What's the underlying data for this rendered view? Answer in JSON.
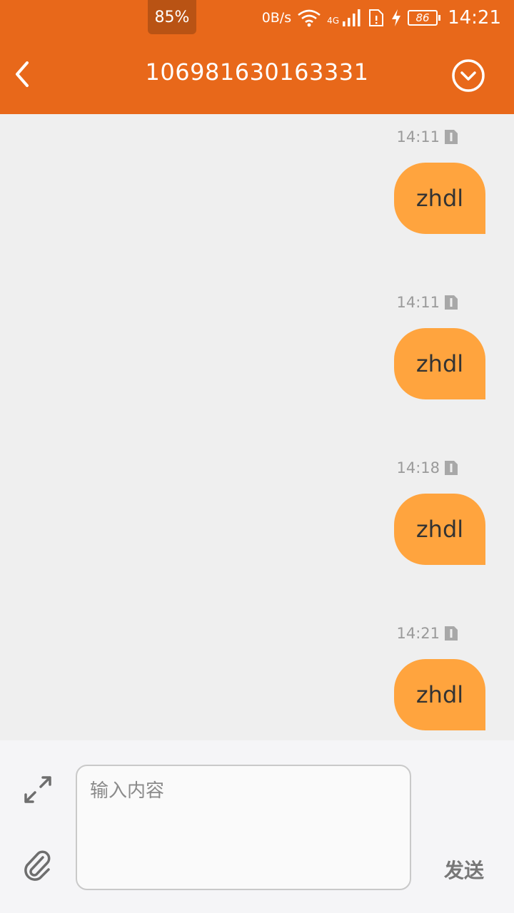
{
  "status_bar": {
    "battery_overlay": "85%",
    "net_speed": "0B/s",
    "network_type": "4G",
    "battery_level": "86",
    "time": "14:21"
  },
  "header": {
    "title": "106981630163331",
    "back_icon": "chevron-left-icon",
    "menu_icon": "chevron-down-circle-icon"
  },
  "messages": [
    {
      "time": "14:11",
      "text": "zhdl"
    },
    {
      "time": "14:11",
      "text": "zhdl"
    },
    {
      "time": "14:18",
      "text": "zhdl"
    },
    {
      "time": "14:21",
      "text": "zhdl"
    }
  ],
  "composer": {
    "placeholder": "输入内容",
    "value": "",
    "send_label": "发送"
  },
  "colors": {
    "accent": "#e8681a",
    "bubble": "#ffa43e",
    "background": "#efefef"
  }
}
